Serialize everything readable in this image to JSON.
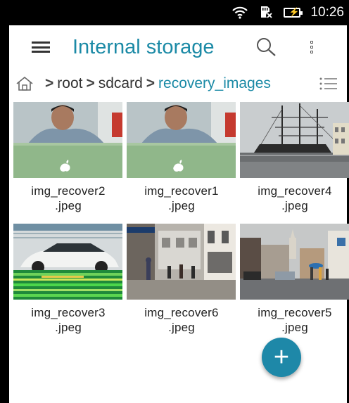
{
  "status_bar": {
    "time": "10:26",
    "icons": [
      "wifi-icon",
      "sd-card-muted-icon",
      "battery-charging-icon"
    ]
  },
  "toolbar": {
    "title": "Internal storage",
    "menu_icon": "hamburger-menu-icon",
    "search_icon": "search-icon",
    "more_icon": "more-vert-icon"
  },
  "breadcrumb": {
    "home_icon": "home-icon",
    "items": [
      "root",
      "sdcard",
      "recovery_images"
    ],
    "separator": ">",
    "view_toggle_icon": "list-view-icon"
  },
  "files": [
    {
      "name_line1": "img_recover2",
      "name_line2": ".jpeg",
      "thumb": "person-laptop"
    },
    {
      "name_line1": "img_recover1",
      "name_line2": ".jpeg",
      "thumb": "person-laptop"
    },
    {
      "name_line1": "img_recover4",
      "name_line2": ".jpeg",
      "thumb": "tall-ship"
    },
    {
      "name_line1": "img_recover3",
      "name_line2": ".jpeg",
      "thumb": "white-car-corrupted"
    },
    {
      "name_line1": "img_recover6",
      "name_line2": ".jpeg",
      "thumb": "street-shops"
    },
    {
      "name_line1": "img_recover5",
      "name_line2": ".jpeg",
      "thumb": "town-street-umbrellas"
    }
  ],
  "fab": {
    "label": "+",
    "icon": "add-icon"
  },
  "colors": {
    "accent": "#1b8aa6",
    "fab": "#1e88a8",
    "status_bar": "#000000"
  }
}
